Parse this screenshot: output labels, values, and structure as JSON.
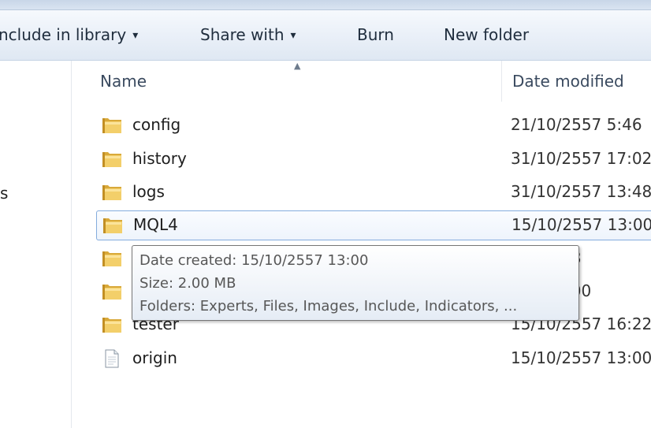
{
  "toolbar": {
    "include_in_library": "nclude in library",
    "share_with": "Share with",
    "burn": "Burn",
    "new_folder": "New folder",
    "dropdown_arrow": "▾"
  },
  "nav": {
    "partial_label": "s"
  },
  "columns": {
    "name": "Name",
    "date_modified": "Date modified",
    "sort_indicator": "▲"
  },
  "files": [
    {
      "name": "config",
      "date": "21/10/2557 5:46",
      "type": "folder-icon"
    },
    {
      "name": "history",
      "date": "31/10/2557 17:02",
      "type": "folder-icon"
    },
    {
      "name": "logs",
      "date": "31/10/2557 13:48",
      "type": "folder-icon"
    },
    {
      "name": "MQL4",
      "date": "15/10/2557 13:00",
      "type": "folder-icon",
      "selected": true
    },
    {
      "name": "",
      "date": "557 6:38",
      "type": "folder-icon"
    },
    {
      "name": "",
      "date": "557 13:00",
      "type": "folder-icon"
    },
    {
      "name": "tester",
      "date": "15/10/2557 16:22",
      "type": "folder-icon"
    },
    {
      "name": "origin",
      "date": "15/10/2557 13:00",
      "type": "file-icon"
    }
  ],
  "tooltip": {
    "date_created": "Date created: 15/10/2557 13:00",
    "size": "Size: 2.00 MB",
    "folders": "Folders: Experts, Files, Images, Include, Indicators, ..."
  }
}
